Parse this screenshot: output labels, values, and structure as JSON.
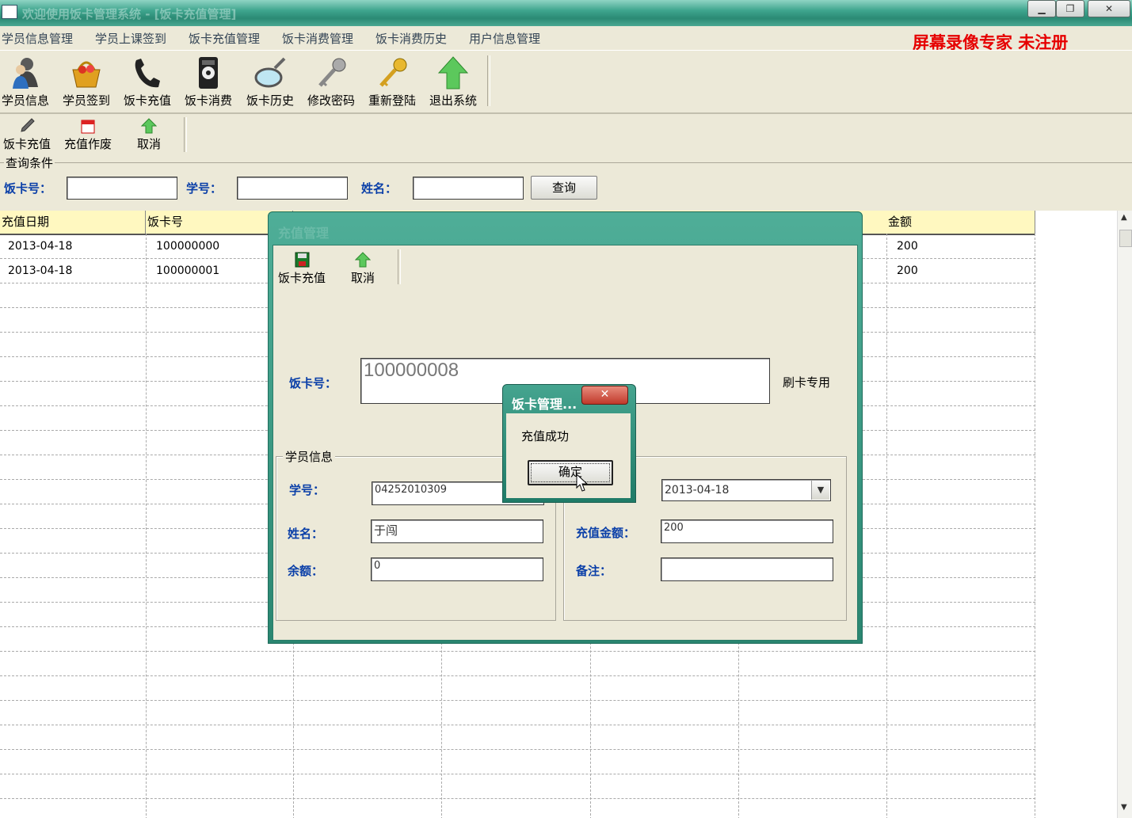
{
  "window": {
    "title": "欢迎使用饭卡管理系统 - [饭卡充值管理]",
    "buttons": [
      "minimize",
      "restore",
      "close"
    ]
  },
  "menu": [
    "学员信息管理",
    "学员上课签到",
    "饭卡充值管理",
    "饭卡消费管理",
    "饭卡消费历史",
    "用户信息管理"
  ],
  "watermark": "屏幕录像专家  未注册",
  "toolbar": [
    {
      "label": "学员信息",
      "icon": "users-icon"
    },
    {
      "label": "学员签到",
      "icon": "basket-icon"
    },
    {
      "label": "饭卡充值",
      "icon": "phone-icon"
    },
    {
      "label": "饭卡消费",
      "icon": "payphone-icon"
    },
    {
      "label": "饭卡历史",
      "icon": "magnifier-icon"
    },
    {
      "label": "修改密码",
      "icon": "key-icon"
    },
    {
      "label": "重新登陆",
      "icon": "gold-key-icon"
    },
    {
      "label": "退出系统",
      "icon": "up-arrow-icon"
    }
  ],
  "subtoolbar": [
    {
      "label": "饭卡充值",
      "icon": "pen-icon"
    },
    {
      "label": "充值作废",
      "icon": "calendar-icon"
    },
    {
      "label": "取消",
      "icon": "up-arrow-icon"
    }
  ],
  "query": {
    "caption": "查询条件",
    "card_label": "饭卡号：",
    "student_label": "学号：",
    "name_label": "姓名：",
    "card_value": "",
    "student_value": "",
    "name_value": "",
    "search_button": "查询"
  },
  "grid": {
    "columns": [
      "充值日期",
      "饭卡号",
      "金额"
    ],
    "rows": [
      {
        "date": "2013-04-18",
        "card": "100000000",
        "amount": "200"
      },
      {
        "date": "2013-04-18",
        "card": "100000001",
        "amount": "200"
      }
    ]
  },
  "dialog": {
    "title": "充值管理",
    "toolbar": [
      {
        "label": "饭卡充值",
        "icon": "save-icon"
      },
      {
        "label": "取消",
        "icon": "up-arrow-icon"
      }
    ],
    "card_label": "饭卡号：",
    "card_value": "100000008",
    "card_hint": "刷卡专用",
    "student_group": "学员信息",
    "student_no_label": "学号：",
    "student_no_value": "04252010309",
    "name_label": "姓名：",
    "name_value": "于闯",
    "balance_label": "余额：",
    "balance_value": "0",
    "date_value": "2013-04-18",
    "amount_label": "充值金额：",
    "amount_value": "200",
    "note_label": "备注：",
    "note_value": ""
  },
  "message": {
    "title": "饭卡管理...",
    "text": "充值成功",
    "ok_button": "确定"
  }
}
